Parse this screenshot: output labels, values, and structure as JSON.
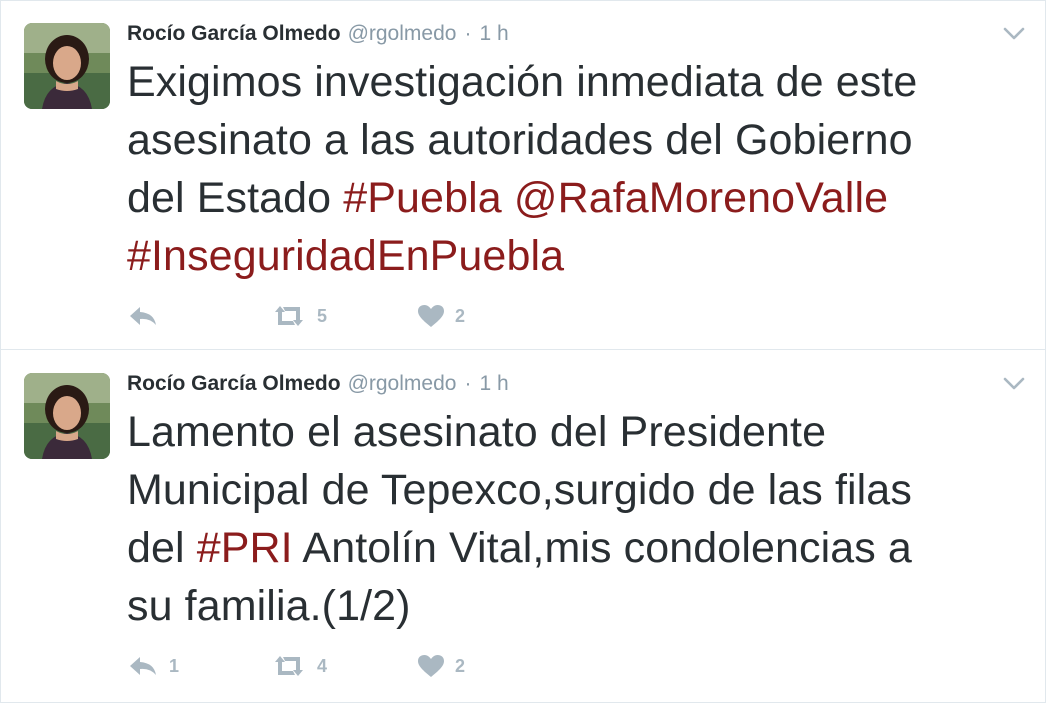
{
  "tweets": [
    {
      "author": {
        "fullname": "Rocío García Olmedo",
        "username": "@rgolmedo"
      },
      "separator": "·",
      "time": "1 h",
      "text_lines": [
        [
          {
            "t": "Exigimos investigación inmediata de este",
            "link": false
          }
        ],
        [
          {
            "t": "asesinato a las autoridades del Gobierno",
            "link": false
          }
        ],
        [
          {
            "t": "del Estado ",
            "link": false
          },
          {
            "t": "#Puebla",
            "link": true
          },
          {
            "t": " ",
            "link": false
          },
          {
            "t": "@RafaMorenoValle",
            "link": true
          }
        ],
        [
          {
            "t": "#InseguridadEnPuebla",
            "link": true
          }
        ]
      ],
      "actions": {
        "reply_count": "",
        "retweet_count": "5",
        "like_count": "2"
      }
    },
    {
      "author": {
        "fullname": "Rocío García Olmedo",
        "username": "@rgolmedo"
      },
      "separator": "·",
      "time": "1 h",
      "text_lines": [
        [
          {
            "t": "Lamento el asesinato del Presidente",
            "link": false
          }
        ],
        [
          {
            "t": "Municipal de Tepexco,surgido de las filas",
            "link": false
          }
        ],
        [
          {
            "t": "del ",
            "link": false
          },
          {
            "t": "#PRI",
            "link": true
          },
          {
            "t": " Antolín Vital,mis condolencias a",
            "link": false
          }
        ],
        [
          {
            "t": "su familia.(1/2)",
            "link": false
          }
        ]
      ],
      "actions": {
        "reply_count": "1",
        "retweet_count": "4",
        "like_count": "2"
      }
    }
  ],
  "colors": {
    "link": "#8b1c1c",
    "muted": "#8899a6",
    "icon": "#aab8c2",
    "border": "#e1e8ed"
  },
  "icons": {
    "reply": "reply-icon",
    "retweet": "retweet-icon",
    "like": "heart-icon",
    "menu": "chevron-down-icon"
  }
}
